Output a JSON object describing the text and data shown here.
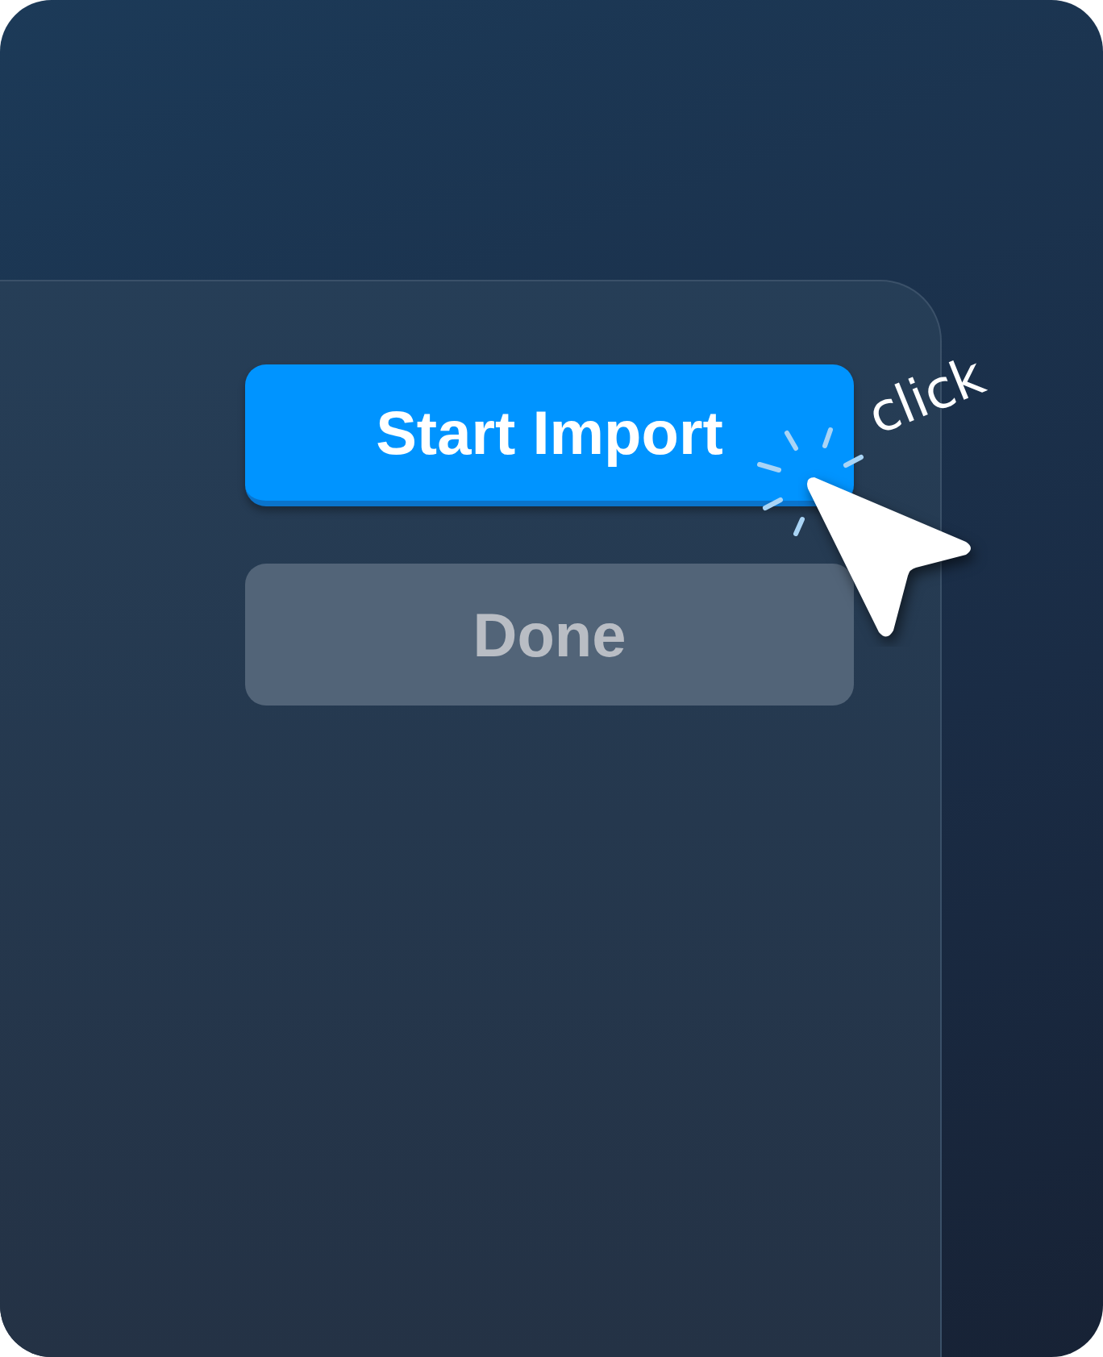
{
  "buttons": [
    {
      "label": "Start Import",
      "kind": "primary",
      "disabled": false
    },
    {
      "label": "Done",
      "kind": "secondary",
      "disabled": true
    }
  ],
  "annotation": {
    "text": "click"
  }
}
